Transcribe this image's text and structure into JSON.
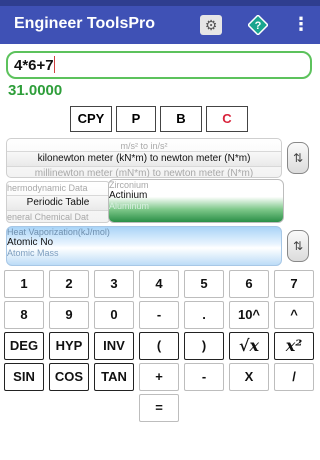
{
  "app": {
    "title": "Engineer ToolsPro",
    "actions": [
      {
        "name": "settings",
        "icon": "gear-icon"
      },
      {
        "name": "help",
        "icon": "help-diamond-icon"
      },
      {
        "name": "overflow-menu",
        "icon": "vertical-dots-icon",
        "glyph": "⋮"
      }
    ],
    "colors": {
      "appbar": "#3f51b5",
      "status_bar": "#2f3e8f",
      "input_border": "#5cc25c",
      "result": "#2e9e3a",
      "help_icon": "#1aa58f"
    }
  },
  "calculator": {
    "expression": "4*6+7",
    "result": "31.0000"
  },
  "toolbar": {
    "buttons": [
      {
        "label": "CPY",
        "color": "#111111"
      },
      {
        "label": "P",
        "color": "#111111"
      },
      {
        "label": "B",
        "color": "#111111"
      },
      {
        "label": "C",
        "color": "#d8233b"
      }
    ]
  },
  "unit_converter": {
    "above": "m/s² to in/s²",
    "selected": "kilonewton meter (kN*m) to newton meter (N*m)",
    "below": "millinewton meter (mN*m) to newton meter (N*m)",
    "swap_icon": "swap-icon"
  },
  "data_picker": {
    "category_above": "hermodynamic Data",
    "category_selected": "Periodic Table",
    "category_below": "eneral Chemical Dat",
    "element_above": "Zirconium",
    "element_selected": "Actinium",
    "element_below": "Aluminum"
  },
  "property_picker": {
    "above": "Heat Vaporization(kJ/mol)",
    "selected": "Atomic No",
    "below": "Atomic Mass",
    "swap_icon": "swap-icon"
  },
  "keypad": {
    "row1": [
      "1",
      "2",
      "3",
      "4",
      "5",
      "6",
      "7"
    ],
    "row2": [
      "8",
      "9",
      "0",
      "-",
      ".",
      "10^",
      "^"
    ],
    "row3": [
      "DEG",
      "HYP",
      "INV",
      "(",
      ")",
      "√x",
      "x²"
    ],
    "row4": [
      "SIN",
      "COS",
      "TAN",
      "+",
      "-",
      "X",
      "/"
    ],
    "row5": [
      "="
    ]
  }
}
